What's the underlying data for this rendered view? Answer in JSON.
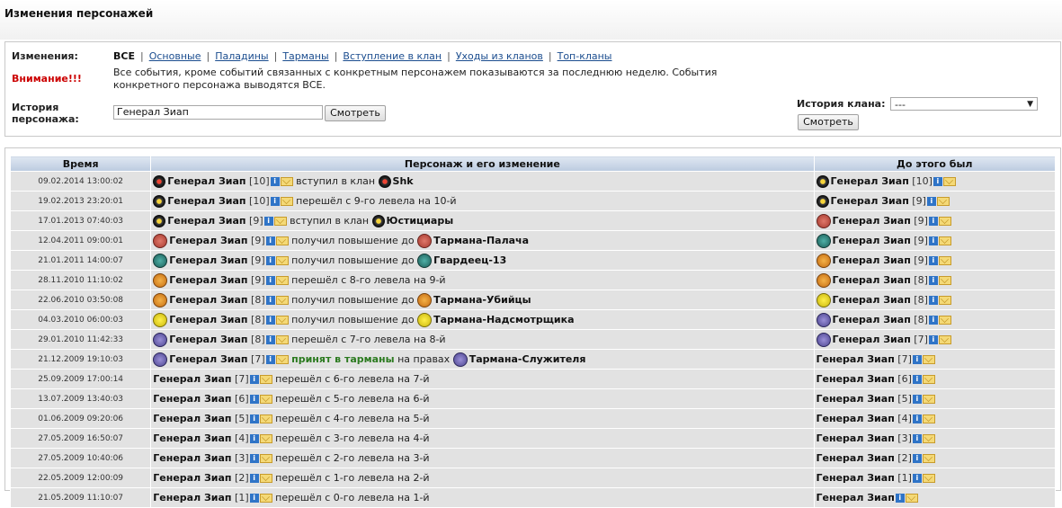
{
  "page_title": "Изменения персонажей",
  "filters": {
    "label": "Изменения:",
    "selected": "ВСЕ",
    "links": [
      "Основные",
      "Паладины",
      "Тарманы",
      "Вступление в клан",
      "Уходы из кланов",
      "Топ-кланы"
    ]
  },
  "warning": {
    "label": "Внимание!!!",
    "text": "Все события, кроме событий связанных с конкретным персонажем показываются за последнюю неделю. События конкретного персонажа выводятся ВСЕ."
  },
  "char_history": {
    "label_line1": "История",
    "label_line2": "персонажа:",
    "input_value": "Генерал Зиап",
    "button": "Смотреть"
  },
  "clan_history": {
    "label": "История клана:",
    "select_value": "---",
    "button": "Смотреть"
  },
  "table": {
    "headers": [
      "Время",
      "Персонаж и его изменение",
      "До этого был"
    ],
    "rows": [
      {
        "time": "09.02.2014 13:00:02",
        "icon": "spiky red",
        "name": "Генерал Зиап",
        "level": "[10]",
        "action": "вступил в клан",
        "target_icon": "spiky red",
        "target": "Shk",
        "prev_icon": "spiky yel",
        "prev_name": "Генерал Зиап",
        "prev_level": "[10]"
      },
      {
        "time": "19.02.2013 23:20:01",
        "icon": "spiky yel",
        "name": "Генерал Зиап",
        "level": "[10]",
        "action": "перешёл с 9-го левела на 10-й",
        "target_icon": "",
        "target": "",
        "prev_icon": "spiky yel",
        "prev_name": "Генерал Зиап",
        "prev_level": "[9]"
      },
      {
        "time": "17.01.2013 07:40:03",
        "icon": "spiky yel",
        "name": "Генерал Зиап",
        "level": "[9]",
        "action": "вступил в клан",
        "target_icon": "spiky yel",
        "target": "Юстициары",
        "prev_icon": "t-red",
        "prev_name": "Генерал Зиап",
        "prev_level": "[9]"
      },
      {
        "time": "12.04.2011 09:00:01",
        "icon": "t-red",
        "name": "Генерал Зиап",
        "level": "[9]",
        "action": "получил повышение до",
        "target_icon": "t-red",
        "target": "Тармана-Палача",
        "prev_icon": "t-teal",
        "prev_name": "Генерал Зиап",
        "prev_level": "[9]"
      },
      {
        "time": "21.01.2011 14:00:07",
        "icon": "t-teal",
        "name": "Генерал Зиап",
        "level": "[9]",
        "action": "получил повышение до",
        "target_icon": "t-teal",
        "target": "Гвардеец-13",
        "prev_icon": "t-orange",
        "prev_name": "Генерал Зиап",
        "prev_level": "[9]"
      },
      {
        "time": "28.11.2010 11:10:02",
        "icon": "t-orange",
        "name": "Генерал Зиап",
        "level": "[9]",
        "action": "перешёл с 8-го левела на 9-й",
        "target_icon": "",
        "target": "",
        "prev_icon": "t-orange",
        "prev_name": "Генерал Зиап",
        "prev_level": "[8]"
      },
      {
        "time": "22.06.2010 03:50:08",
        "icon": "t-orange",
        "name": "Генерал Зиап",
        "level": "[8]",
        "action": "получил повышение до",
        "target_icon": "t-orange",
        "target": "Тармана-Убийцы",
        "prev_icon": "t-yellow",
        "prev_name": "Генерал Зиап",
        "prev_level": "[8]"
      },
      {
        "time": "04.03.2010 06:00:03",
        "icon": "t-yellow",
        "name": "Генерал Зиап",
        "level": "[8]",
        "action": "получил повышение до",
        "target_icon": "t-yellow",
        "target": "Тармана-Надсмотрщика",
        "prev_icon": "t-purple",
        "prev_name": "Генерал Зиап",
        "prev_level": "[8]"
      },
      {
        "time": "29.01.2010 11:42:33",
        "icon": "t-purple",
        "name": "Генерал Зиап",
        "level": "[8]",
        "action": "перешёл с 7-го левела на 8-й",
        "target_icon": "",
        "target": "",
        "prev_icon": "t-purple",
        "prev_name": "Генерал Зиап",
        "prev_level": "[7]"
      },
      {
        "time": "21.12.2009 19:10:03",
        "icon": "t-purple",
        "name": "Генерал Зиап",
        "level": "[7]",
        "action_green": "принят в тарманы",
        "action": "на правах",
        "target_icon": "t-purple",
        "target": "Тармана-Служителя",
        "prev_icon": "",
        "prev_name": "Генерал Зиап",
        "prev_level": "[7]"
      },
      {
        "time": "25.09.2009 17:00:14",
        "icon": "",
        "name": "Генерал Зиап",
        "level": "[7]",
        "action": "перешёл с 6-го левела на 7-й",
        "target_icon": "",
        "target": "",
        "prev_icon": "",
        "prev_name": "Генерал Зиап",
        "prev_level": "[6]"
      },
      {
        "time": "13.07.2009 13:40:03",
        "icon": "",
        "name": "Генерал Зиап",
        "level": "[6]",
        "action": "перешёл с 5-го левела на 6-й",
        "target_icon": "",
        "target": "",
        "prev_icon": "",
        "prev_name": "Генерал Зиап",
        "prev_level": "[5]"
      },
      {
        "time": "01.06.2009 09:20:06",
        "icon": "",
        "name": "Генерал Зиап",
        "level": "[5]",
        "action": "перешёл с 4-го левела на 5-й",
        "target_icon": "",
        "target": "",
        "prev_icon": "",
        "prev_name": "Генерал Зиап",
        "prev_level": "[4]"
      },
      {
        "time": "27.05.2009 16:50:07",
        "icon": "",
        "name": "Генерал Зиап",
        "level": "[4]",
        "action": "перешёл с 3-го левела на 4-й",
        "target_icon": "",
        "target": "",
        "prev_icon": "",
        "prev_name": "Генерал Зиап",
        "prev_level": "[3]"
      },
      {
        "time": "27.05.2009 10:40:06",
        "icon": "",
        "name": "Генерал Зиап",
        "level": "[3]",
        "action": "перешёл с 2-го левела на 3-й",
        "target_icon": "",
        "target": "",
        "prev_icon": "",
        "prev_name": "Генерал Зиап",
        "prev_level": "[2]"
      },
      {
        "time": "22.05.2009 12:00:09",
        "icon": "",
        "name": "Генерал Зиап",
        "level": "[2]",
        "action": "перешёл с 1-го левела на 2-й",
        "target_icon": "",
        "target": "",
        "prev_icon": "",
        "prev_name": "Генерал Зиап",
        "prev_level": "[1]"
      },
      {
        "time": "21.05.2009 11:10:07",
        "icon": "",
        "name": "Генерал Зиап",
        "level": "[1]",
        "action": "перешёл с 0-го левела на 1-й",
        "target_icon": "",
        "target": "",
        "prev_icon": "",
        "prev_name": "Генерал Зиап",
        "prev_level": ""
      }
    ]
  },
  "icons": {
    "info": "i",
    "mail": "mail-icon"
  }
}
